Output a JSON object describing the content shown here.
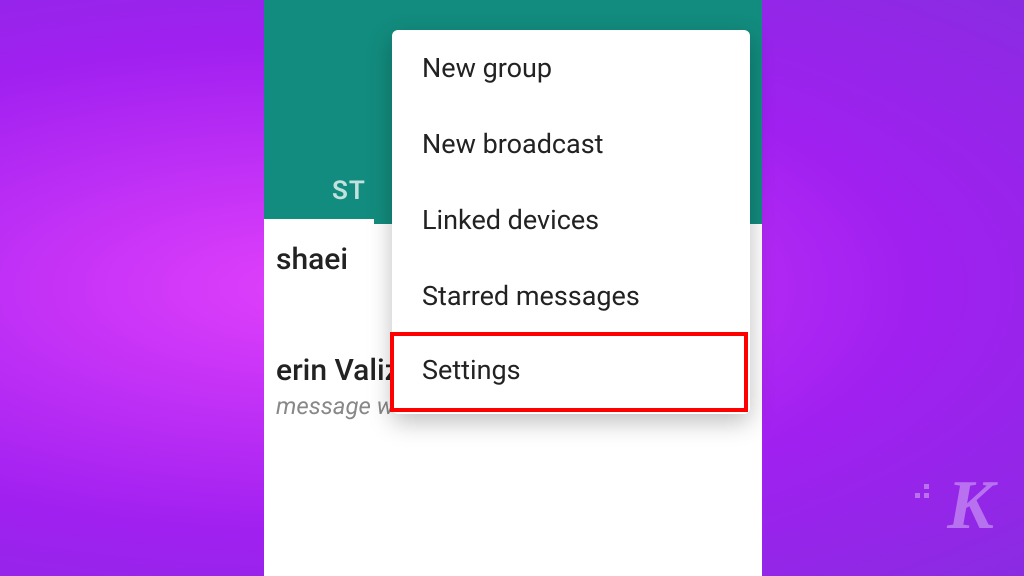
{
  "header": {
    "tab_status_label": "ST"
  },
  "chats": [
    {
      "name": "shaei",
      "preview": ""
    },
    {
      "name": "erin Valiz",
      "preview": "message w"
    }
  ],
  "menu": {
    "items": [
      "New group",
      "New broadcast",
      "Linked devices",
      "Starred messages",
      "Settings"
    ]
  },
  "watermark": "K"
}
